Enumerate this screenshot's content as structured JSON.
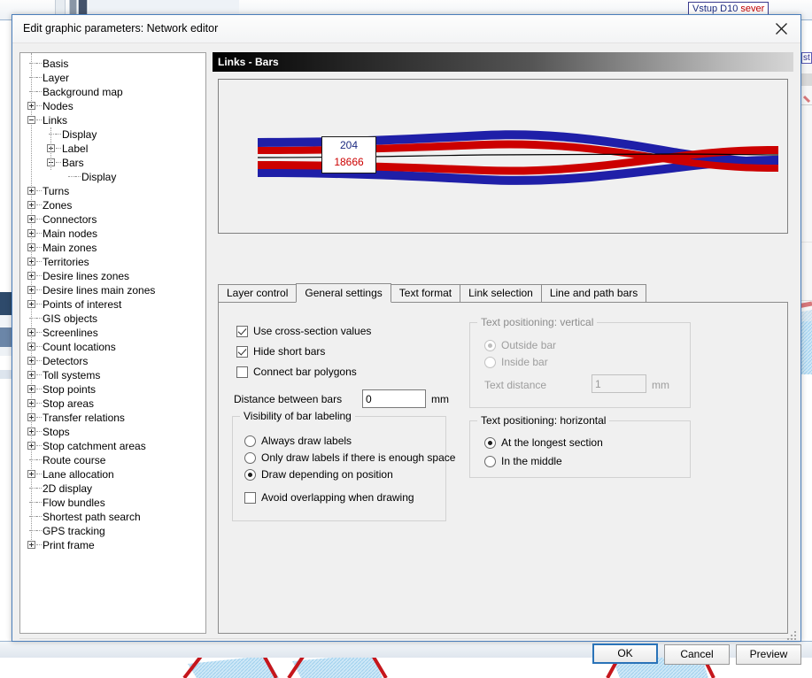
{
  "background": {
    "map_label": {
      "text_part1": "Vstup D10 ",
      "text_part2": "sever"
    },
    "edge_label": {
      "text": "st"
    }
  },
  "dialog": {
    "title": "Edit graphic parameters: Network editor",
    "close_icon": "close-icon",
    "section_header": "Links - Bars",
    "tree": {
      "items": [
        {
          "label": "Basis",
          "depth": 0,
          "toggle": "none"
        },
        {
          "label": "Layer",
          "depth": 0,
          "toggle": "none"
        },
        {
          "label": "Background map",
          "depth": 0,
          "toggle": "none"
        },
        {
          "label": "Nodes",
          "depth": 0,
          "toggle": "plus"
        },
        {
          "label": "Links",
          "depth": 0,
          "toggle": "minus"
        },
        {
          "label": "Display",
          "depth": 1,
          "toggle": "none"
        },
        {
          "label": "Label",
          "depth": 1,
          "toggle": "plus"
        },
        {
          "label": "Bars",
          "depth": 1,
          "toggle": "minus"
        },
        {
          "label": "Display",
          "depth": 2,
          "toggle": "none"
        },
        {
          "label": "Turns",
          "depth": 0,
          "toggle": "plus"
        },
        {
          "label": "Zones",
          "depth": 0,
          "toggle": "plus"
        },
        {
          "label": "Connectors",
          "depth": 0,
          "toggle": "plus"
        },
        {
          "label": "Main nodes",
          "depth": 0,
          "toggle": "plus"
        },
        {
          "label": "Main zones",
          "depth": 0,
          "toggle": "plus"
        },
        {
          "label": "Territories",
          "depth": 0,
          "toggle": "plus"
        },
        {
          "label": "Desire lines zones",
          "depth": 0,
          "toggle": "plus"
        },
        {
          "label": "Desire lines main zones",
          "depth": 0,
          "toggle": "plus"
        },
        {
          "label": "Points of interest",
          "depth": 0,
          "toggle": "plus"
        },
        {
          "label": "GIS objects",
          "depth": 0,
          "toggle": "none"
        },
        {
          "label": "Screenlines",
          "depth": 0,
          "toggle": "plus"
        },
        {
          "label": "Count locations",
          "depth": 0,
          "toggle": "plus"
        },
        {
          "label": "Detectors",
          "depth": 0,
          "toggle": "plus"
        },
        {
          "label": "Toll systems",
          "depth": 0,
          "toggle": "plus"
        },
        {
          "label": "Stop points",
          "depth": 0,
          "toggle": "plus"
        },
        {
          "label": "Stop areas",
          "depth": 0,
          "toggle": "plus"
        },
        {
          "label": "Transfer relations",
          "depth": 0,
          "toggle": "plus"
        },
        {
          "label": "Stops",
          "depth": 0,
          "toggle": "plus"
        },
        {
          "label": "Stop catchment areas",
          "depth": 0,
          "toggle": "plus"
        },
        {
          "label": "Route course",
          "depth": 0,
          "toggle": "none"
        },
        {
          "label": "Lane allocation",
          "depth": 0,
          "toggle": "plus"
        },
        {
          "label": "2D display",
          "depth": 0,
          "toggle": "none"
        },
        {
          "label": "Flow bundles",
          "depth": 0,
          "toggle": "none"
        },
        {
          "label": "Shortest path search",
          "depth": 0,
          "toggle": "none"
        },
        {
          "label": "GPS tracking",
          "depth": 0,
          "toggle": "none"
        },
        {
          "label": "Print frame",
          "depth": 0,
          "toggle": "plus"
        }
      ]
    },
    "preview": {
      "bar_label_top": "204",
      "bar_label_bottom": "18666",
      "colors": {
        "outer_bar": "#1f1fa8",
        "inner_bar": "#cc0000",
        "link_line": "#000000"
      }
    },
    "tabs": [
      {
        "label": "Layer control",
        "active": false
      },
      {
        "label": "General settings",
        "active": true
      },
      {
        "label": "Text format",
        "active": false
      },
      {
        "label": "Link selection",
        "active": false
      },
      {
        "label": "Line and path bars",
        "active": false
      }
    ],
    "general_settings": {
      "checkboxes": [
        {
          "label": "Use cross-section values",
          "checked": true,
          "disabled": false
        },
        {
          "label": "Hide short bars",
          "checked": true,
          "disabled": false
        },
        {
          "label": "Connect bar polygons",
          "checked": false,
          "disabled": false
        }
      ],
      "distance_between_bars": {
        "label": "Distance between bars",
        "value": "0",
        "unit": "mm"
      },
      "visibility_group": {
        "title": "Visibility of bar labeling",
        "options": [
          {
            "label": "Always draw labels",
            "selected": false
          },
          {
            "label": "Only draw labels if there is enough space",
            "selected": false
          },
          {
            "label": "Draw depending on position",
            "selected": true
          }
        ],
        "avoid_overlap": {
          "label": "Avoid overlapping when drawing",
          "checked": false
        }
      },
      "vertical_group": {
        "title": "Text positioning: vertical",
        "disabled": true,
        "options": [
          {
            "label": "Outside bar",
            "selected": true
          },
          {
            "label": "Inside bar",
            "selected": false
          }
        ],
        "text_distance": {
          "label": "Text distance",
          "value": "1",
          "unit": "mm"
        }
      },
      "horizontal_group": {
        "title": "Text positioning: horizontal",
        "disabled": false,
        "options": [
          {
            "label": "At the longest section",
            "selected": true
          },
          {
            "label": "In the middle",
            "selected": false
          }
        ]
      }
    },
    "footer": {
      "ok": "OK",
      "cancel": "Cancel",
      "preview": "Preview"
    }
  }
}
